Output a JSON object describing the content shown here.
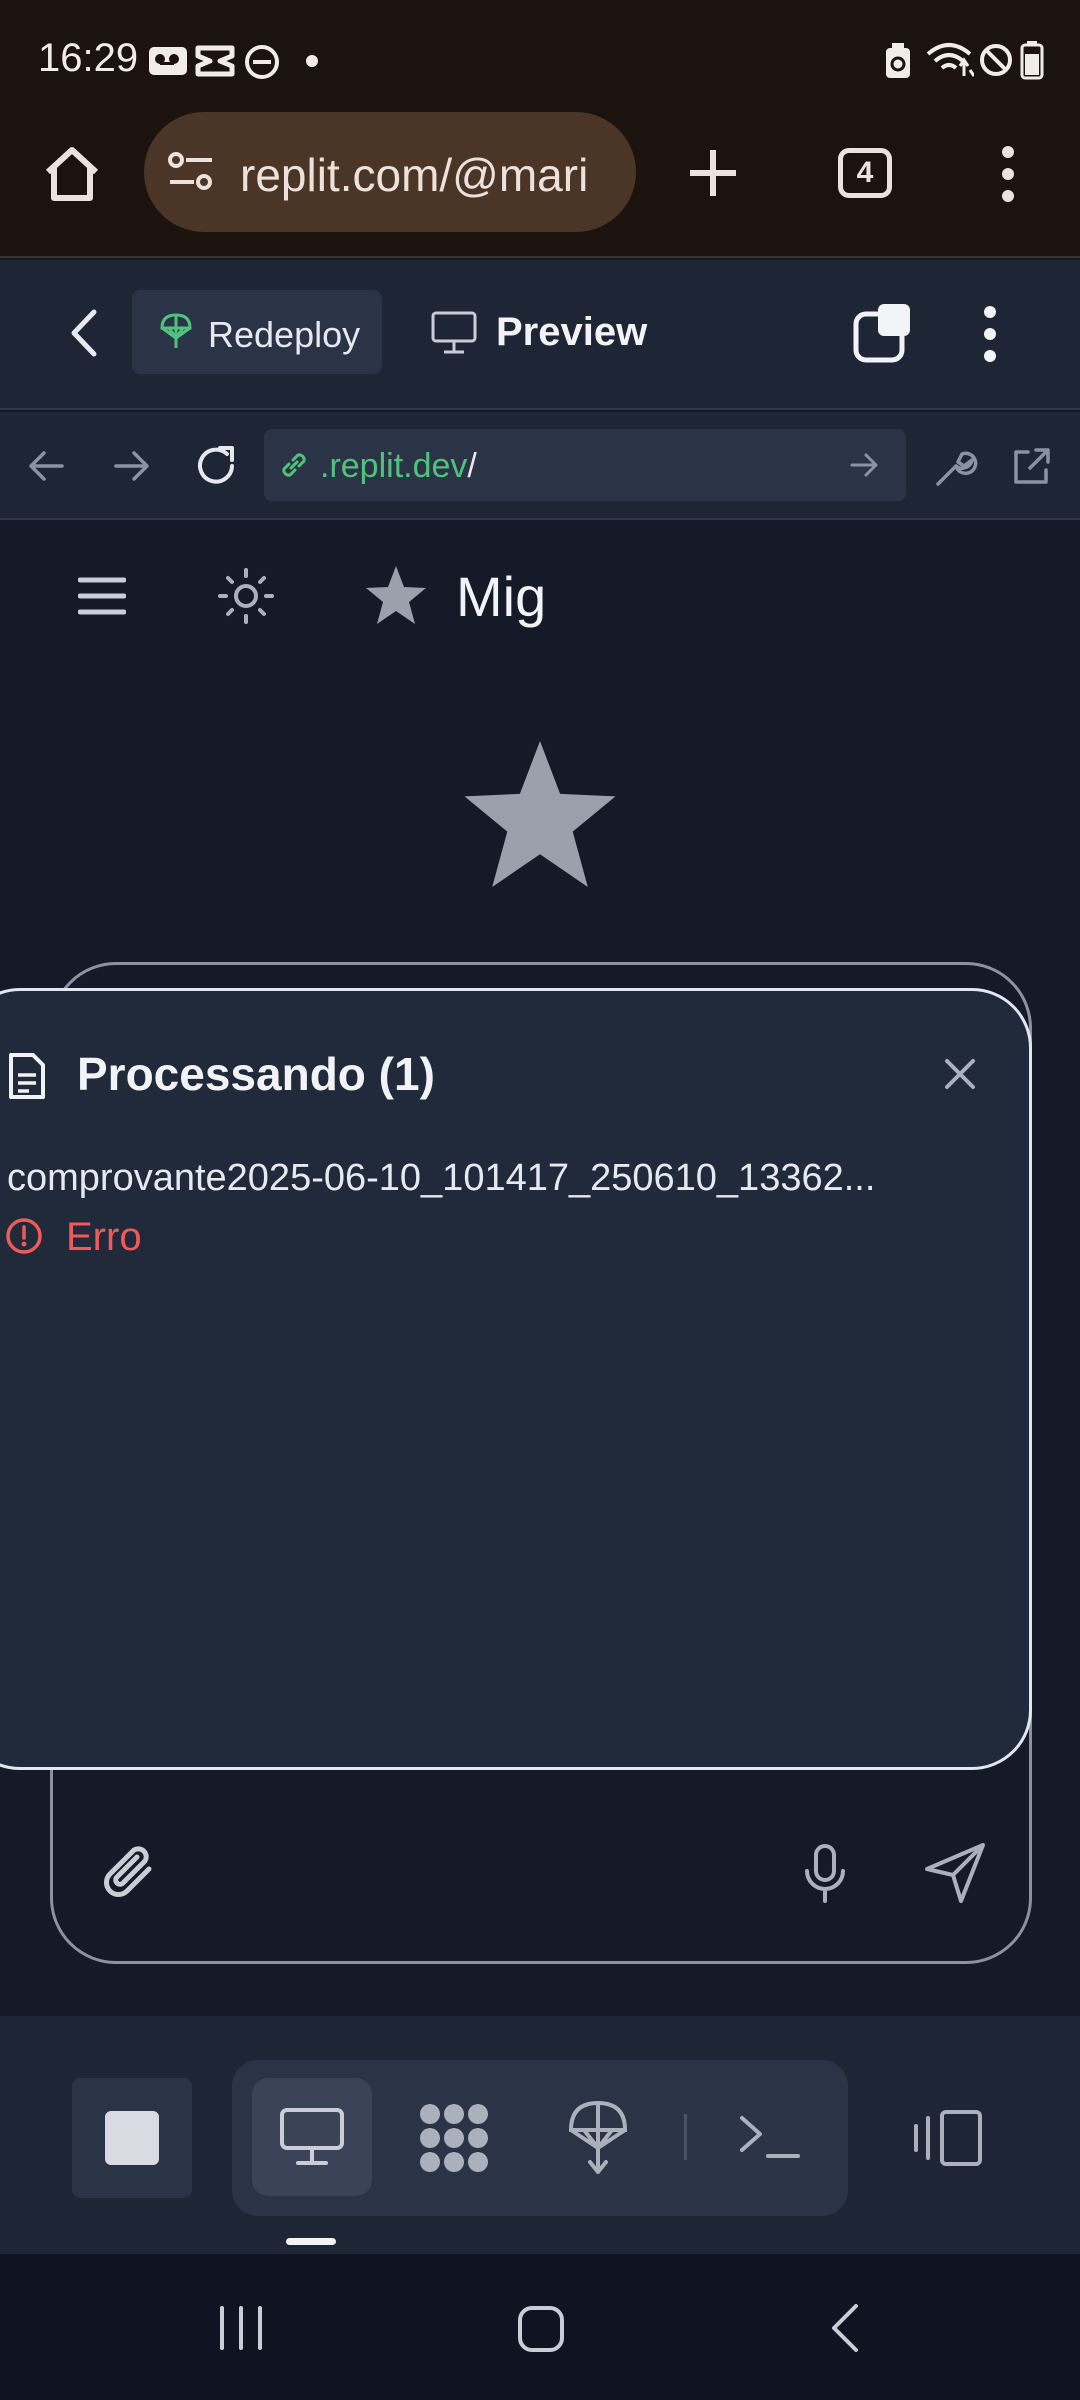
{
  "status_bar": {
    "time": "16:29"
  },
  "browser": {
    "url_text": "replit.com/@mari",
    "tab_count": "4"
  },
  "replit_header": {
    "redeploy_label": "Redeploy",
    "preview_label": "Preview"
  },
  "webview": {
    "url_domain": ".replit.dev",
    "url_path": "/"
  },
  "app": {
    "title": "Mig"
  },
  "modal": {
    "title": "Processando (1)",
    "file_name": "comprovante2025-06-10_101417_250610_13362...",
    "status": "Erro"
  },
  "colors": {
    "success": "#4fc37e",
    "error": "#ef5a5a",
    "surface": "#212a3a",
    "background": "#141a28"
  }
}
